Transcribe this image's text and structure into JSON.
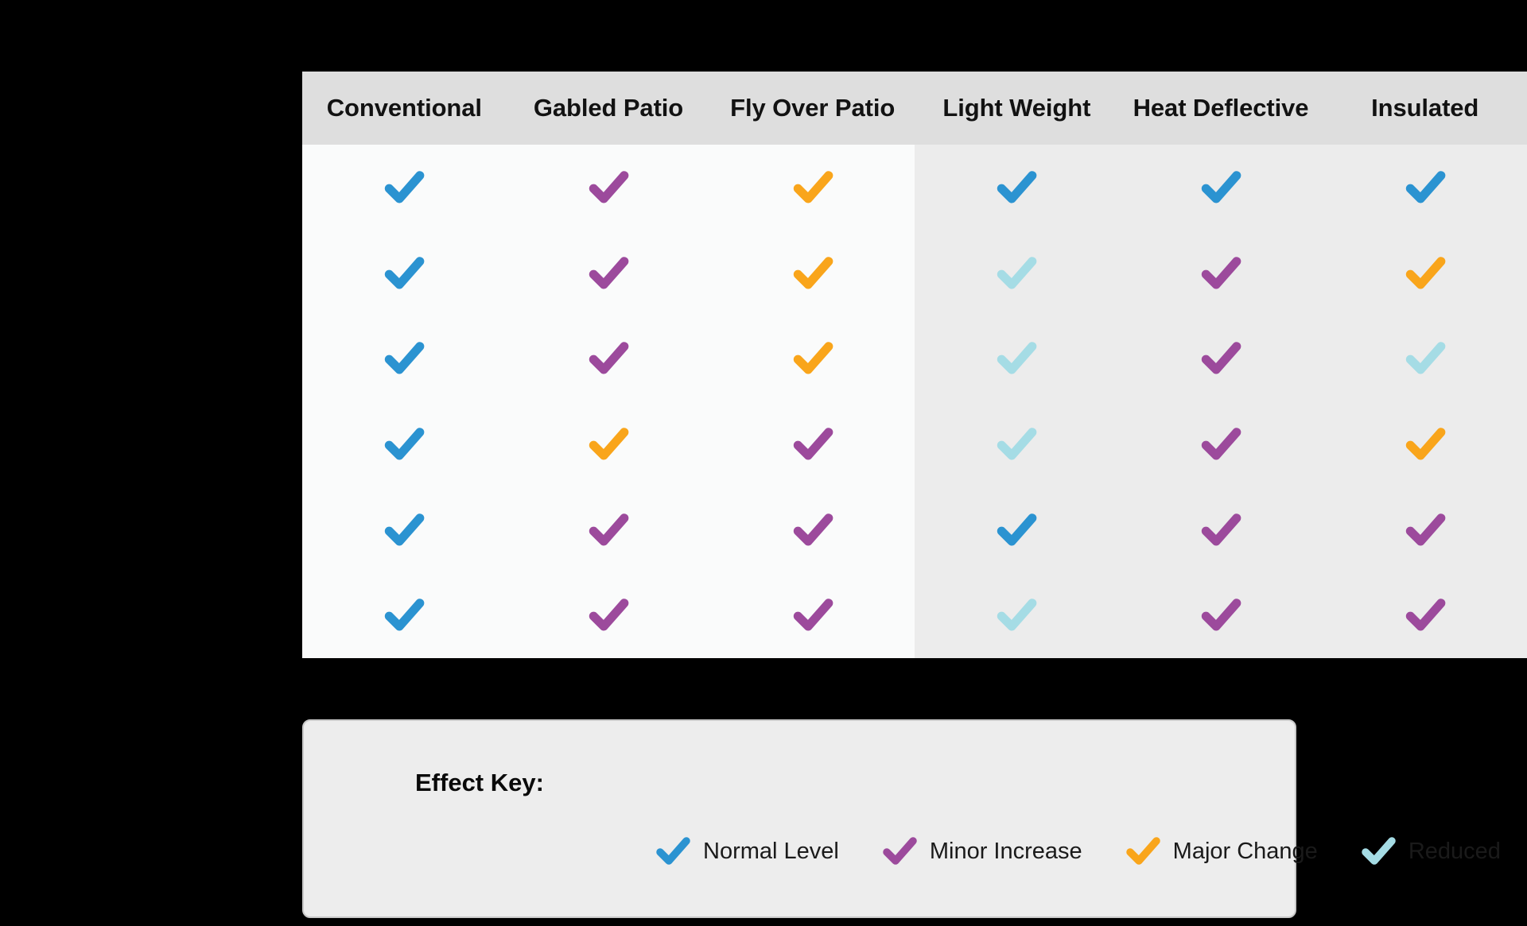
{
  "palette": {
    "normal_level": "#2b93d1",
    "minor_increase": "#9c4a9c",
    "major_change": "#f9a51b",
    "reduced": "#a5dce5",
    "header_bg": "#dedede",
    "panel_left_bg": "#fafbfb",
    "panel_right_bg": "#ececec",
    "legend_bg": "#ededed",
    "page_bg": "#000000"
  },
  "table": {
    "columns": [
      {
        "label": "Conventional",
        "panel": "left"
      },
      {
        "label": "Gabled Patio",
        "panel": "left"
      },
      {
        "label": "Fly Over Patio",
        "panel": "left"
      },
      {
        "label": "Light Weight",
        "panel": "right"
      },
      {
        "label": "Heat Deflective",
        "panel": "right"
      },
      {
        "label": "Insulated",
        "panel": "right"
      }
    ],
    "row_count": 6,
    "cells": [
      [
        "normal_level",
        "minor_increase",
        "major_change",
        "normal_level",
        "normal_level",
        "normal_level"
      ],
      [
        "normal_level",
        "minor_increase",
        "major_change",
        "reduced",
        "minor_increase",
        "major_change"
      ],
      [
        "normal_level",
        "minor_increase",
        "major_change",
        "reduced",
        "minor_increase",
        "reduced"
      ],
      [
        "normal_level",
        "major_change",
        "minor_increase",
        "reduced",
        "minor_increase",
        "major_change"
      ],
      [
        "normal_level",
        "minor_increase",
        "minor_increase",
        "normal_level",
        "minor_increase",
        "minor_increase"
      ],
      [
        "normal_level",
        "minor_increase",
        "minor_increase",
        "reduced",
        "minor_increase",
        "minor_increase"
      ]
    ]
  },
  "legend": {
    "title": "Effect Key:",
    "items": [
      {
        "key": "normal_level",
        "label": "Normal Level"
      },
      {
        "key": "minor_increase",
        "label": "Minor Increase"
      },
      {
        "key": "major_change",
        "label": "Major Change"
      },
      {
        "key": "reduced",
        "label": "Reduced"
      }
    ]
  },
  "icons": {
    "check": "check-icon"
  }
}
